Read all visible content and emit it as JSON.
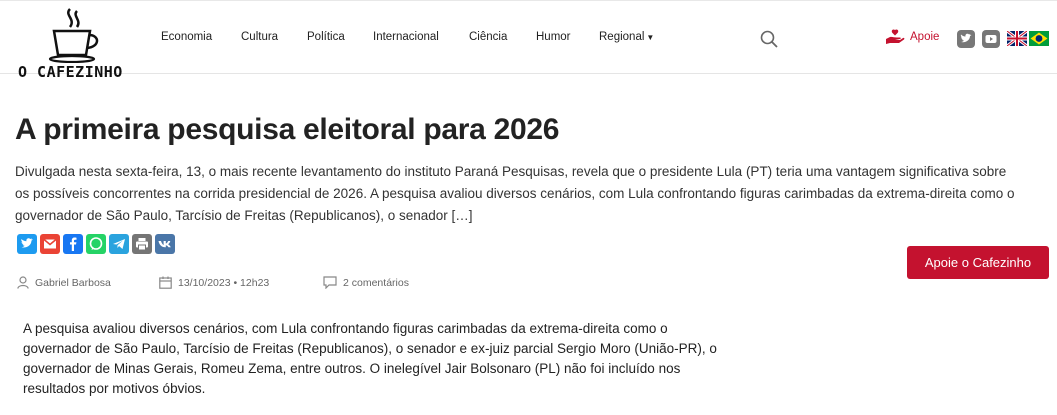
{
  "header": {
    "logo_text": "O CAFEZINHO",
    "nav": [
      {
        "label": "Economia"
      },
      {
        "label": "Cultura"
      },
      {
        "label": "Política"
      },
      {
        "label": "Internacional"
      },
      {
        "label": "Ciência"
      },
      {
        "label": "Humor"
      },
      {
        "label": "Regional"
      }
    ],
    "apoie_label": "Apoie",
    "social_icons": [
      "twitter-icon",
      "youtube-icon"
    ],
    "flags": [
      "uk-flag",
      "brazil-flag"
    ]
  },
  "article": {
    "title": "A primeira pesquisa eleitoral para 2026",
    "excerpt": "Divulgada nesta sexta-feira, 13, o mais recente levantamento do instituto Paraná Pesquisas, revela que o presidente Lula (PT) teria uma vantagem significativa sobre os possíveis concorrentes na corrida presidencial de 2026. A pesquisa avaliou diversos cenários, com Lula confrontando figuras carimbadas da extrema-direita como o governador de São Paulo, Tarcísio de Freitas (Republicanos), o senador […]",
    "share_icons": [
      "twitter",
      "gmail",
      "facebook",
      "whatsapp",
      "telegram",
      "print",
      "vk"
    ],
    "author": "Gabriel Barbosa",
    "date": "13/10/2023 • 12h23",
    "comments": "2 comentários",
    "support_button": "Apoie o Cafezinho",
    "body": "A pesquisa avaliou diversos cenários, com Lula confrontando figuras carimbadas da extrema-direita como o governador de São Paulo, Tarcísio de Freitas (Republicanos), o senador e ex-juiz parcial Sergio Moro (União-PR), o governador de Minas Gerais, Romeu Zema, entre outros. O inelegível Jair Bolsonaro (PL) não foi incluído nos resultados por motivos óbvios."
  },
  "colors": {
    "accent": "#c4122f",
    "twitter": "#1d9bf0",
    "gmail": "#ea4335",
    "facebook": "#1877f2",
    "whatsapp": "#25d366",
    "telegram": "#2aa3de",
    "print": "#757575",
    "vk": "#4a76a8"
  }
}
